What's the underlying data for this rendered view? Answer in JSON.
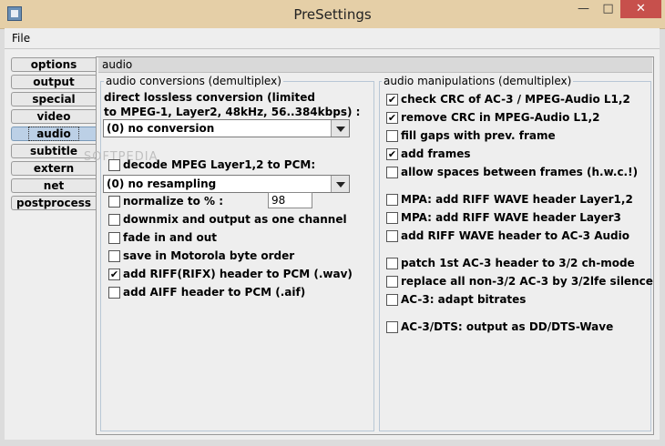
{
  "window": {
    "title": "PreSettings"
  },
  "menubar": {
    "file": "File"
  },
  "tabs": [
    "options",
    "output",
    "special",
    "video",
    "audio",
    "subtitle",
    "extern",
    "net",
    "postprocess"
  ],
  "selected_tab": "audio",
  "panel": {
    "header": "audio"
  },
  "watermark": "SOFTPEDIA",
  "left_group": {
    "title": "audio conversions (demultiplex)",
    "lossless_line1": "direct lossless conversion (limited",
    "lossless_line2": "to MPEG-1, Layer2, 48kHz, 56..384kbps) :",
    "conversion_combo": "(0) no conversion",
    "decode_pcm": {
      "label": "decode MPEG Layer1,2 to PCM:",
      "checked": false
    },
    "resampling_combo": "(0) no resampling",
    "normalize": {
      "label": "normalize to % :",
      "checked": false,
      "value": "98"
    },
    "downmix": {
      "label": "downmix and output as one channel",
      "checked": false
    },
    "fade": {
      "label": "fade in and out",
      "checked": false
    },
    "motorola": {
      "label": "save in Motorola byte order",
      "checked": false
    },
    "riff": {
      "label": "add RIFF(RIFX) header to PCM (.wav)",
      "checked": true
    },
    "aiff": {
      "label": "add AIFF header to PCM (.aif)",
      "checked": false
    }
  },
  "right_group": {
    "title": "audio manipulations (demultiplex)",
    "items": [
      {
        "label": "check CRC of AC-3 / MPEG-Audio L1,2",
        "checked": true
      },
      {
        "label": "remove CRC in MPEG-Audio L1,2",
        "checked": true
      },
      {
        "label": "fill gaps with prev. frame",
        "checked": false
      },
      {
        "label": "add frames",
        "checked": true
      },
      {
        "label": "allow spaces between frames (h.w.c.!)",
        "checked": false
      },
      {
        "label": "MPA: add RIFF WAVE header Layer1,2",
        "checked": false
      },
      {
        "label": "MPA: add RIFF WAVE header Layer3",
        "checked": false
      },
      {
        "label": "add RIFF WAVE header to AC-3 Audio",
        "checked": false
      },
      {
        "label": "patch 1st AC-3 header to 3/2 ch-mode",
        "checked": false
      },
      {
        "label": "replace all non-3/2 AC-3 by 3/2lfe silence",
        "checked": false
      },
      {
        "label": "AC-3: adapt bitrates",
        "checked": false
      },
      {
        "label": "AC-3/DTS: output as DD/DTS-Wave",
        "checked": false
      }
    ]
  }
}
